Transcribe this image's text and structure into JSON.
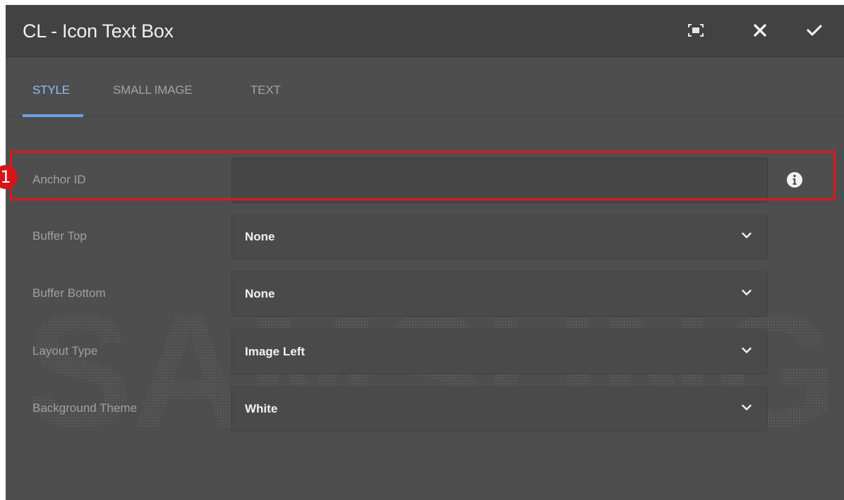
{
  "dialog": {
    "title": "CL - Icon Text Box",
    "actions": {
      "fullscreen_icon": "fullscreen-icon",
      "close_icon": "close-icon",
      "confirm_icon": "check-icon"
    }
  },
  "tabs": [
    {
      "label": "STYLE",
      "active": true
    },
    {
      "label": "SMALL IMAGE",
      "active": false
    },
    {
      "label": "TEXT",
      "active": false
    }
  ],
  "fields": {
    "anchor_id": {
      "label": "Anchor ID",
      "value": "",
      "info_icon": "info-icon"
    },
    "buffer_top": {
      "label": "Buffer Top",
      "value": "None"
    },
    "buffer_bottom": {
      "label": "Buffer Bottom",
      "value": "None"
    },
    "layout_type": {
      "label": "Layout Type",
      "value": "Image Left"
    },
    "background_theme": {
      "label": "Background Theme",
      "value": "White"
    }
  },
  "annotation": {
    "badge_number": "1",
    "color": "#e1161c"
  },
  "watermark": {
    "text": "SAMSUNG"
  },
  "colors": {
    "panel": "#4e4e4e",
    "titlebar": "#424242",
    "active_tab": "#8ec0f5",
    "tab_underline": "#6aa2e6"
  }
}
